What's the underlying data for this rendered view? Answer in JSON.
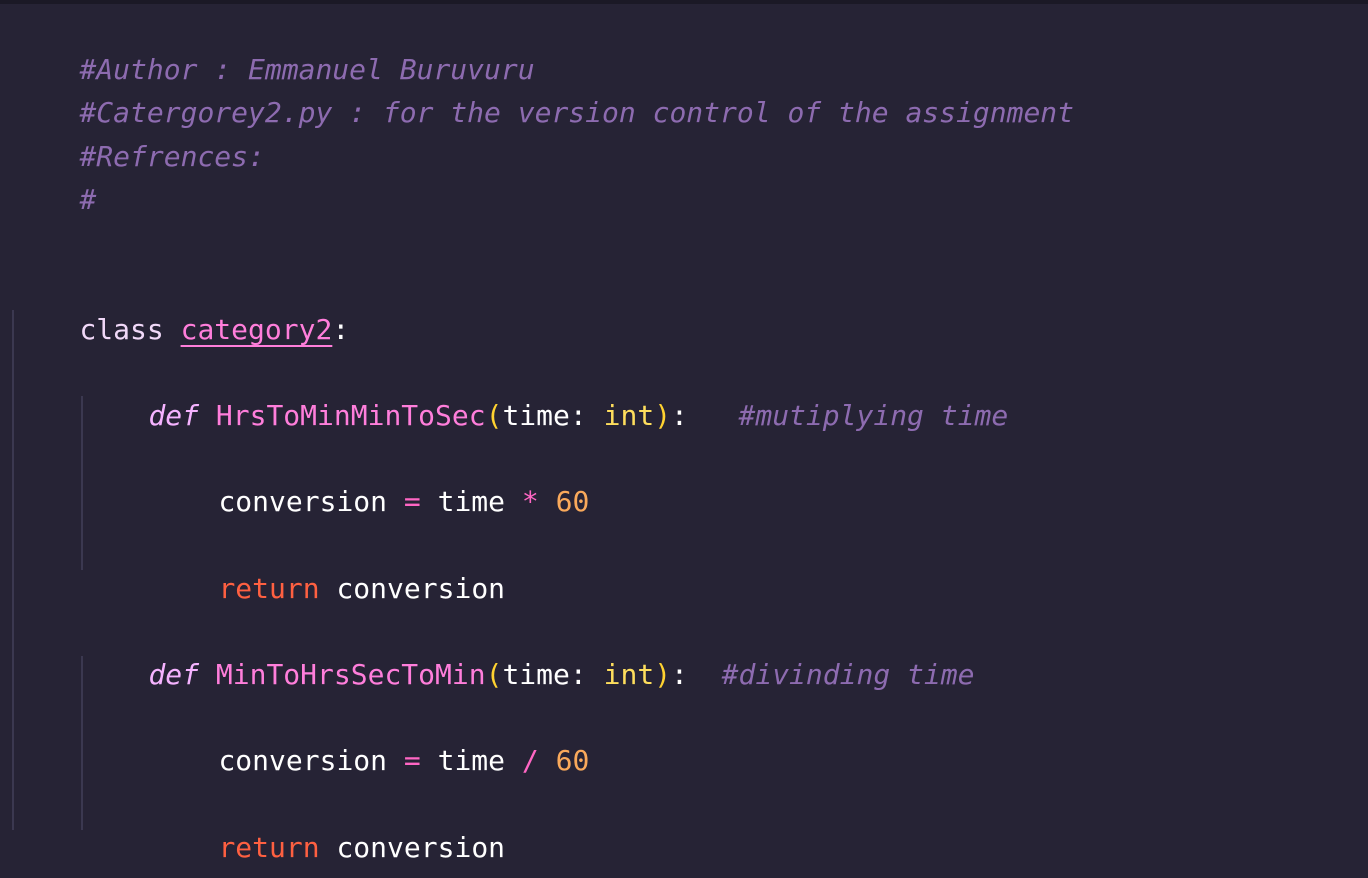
{
  "code": {
    "comment_author": "#Author : Emmanuel Buruvuru",
    "comment_file": "#Catergorey2.py : for the version control of the assignment",
    "comment_refs": "#Refrences:",
    "comment_hash": "#",
    "class_kw": "class",
    "class_name": "category2",
    "colon": ":",
    "def1": {
      "kw": "def",
      "name": "HrsToMinMinToSec",
      "open": "(",
      "param": "time",
      "sep": ": ",
      "type": "int",
      "close": ")",
      "end": ":",
      "comment": "#mutiplying time"
    },
    "body1_assign": {
      "lhs": "conversion",
      "eq": "=",
      "var": "time",
      "op": "*",
      "num": "60"
    },
    "body1_return": {
      "kw": "return",
      "val": "conversion"
    },
    "def2": {
      "kw": "def",
      "name": "MinToHrsSecToMin",
      "open": "(",
      "param": "time",
      "sep": ": ",
      "type": "int",
      "close": ")",
      "end": ":",
      "comment": "#divinding time"
    },
    "body2_assign": {
      "lhs": "conversion",
      "eq": "=",
      "var": "time",
      "op": "/",
      "num": "60"
    },
    "body2_return": {
      "kw": "return",
      "val": "conversion"
    }
  },
  "colors": {
    "background": "#262335",
    "comment": "#8d6bb0",
    "function_name": "#ff7edb",
    "type": "#fede5d",
    "number": "#f9a95b",
    "return_keyword": "#fe6041"
  }
}
